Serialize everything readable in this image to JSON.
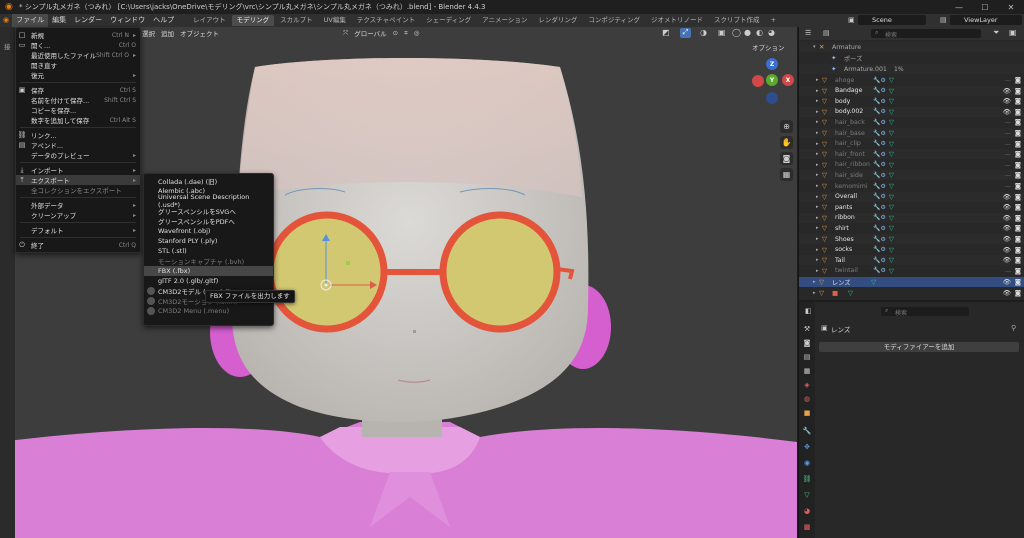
{
  "window": {
    "title": "* シンプル丸メガネ（つみれ） [C:\\Users\\jacks\\OneDrive\\モデリング\\vrc\\シンプル丸メガネ\\シンプル丸メガネ（つみれ）.blend] - Blender 4.4.3",
    "minimize": "—",
    "maximize": "☐",
    "close": "✕"
  },
  "topbar": {
    "menus": [
      "ファイル",
      "編集",
      "レンダー",
      "ウィンドウ",
      "ヘルプ"
    ],
    "workspaces": [
      "レイアウト",
      "モデリング",
      "スカルプト",
      "UV編集",
      "テクスチャペイント",
      "シェーディング",
      "アニメーション",
      "レンダリング",
      "コンポジティング",
      "ジオメトリノード",
      "スクリプト作成"
    ],
    "add_workspace": "+",
    "scene": "Scene",
    "view_layer": "ViewLayer"
  },
  "viewport": {
    "header_menus": [
      "選択",
      "追加",
      "オブジェクト"
    ],
    "transform_orientation": "グローバル",
    "options": "オプション",
    "left_label": "接",
    "gizmo": {
      "z": "Z",
      "y": "Y",
      "x": "X"
    }
  },
  "file_menu": {
    "items": [
      {
        "icon": "□",
        "label": "新規",
        "shortcut": "Ctrl N",
        "arrow": "▸"
      },
      {
        "icon": "▭",
        "label": "開く...",
        "shortcut": "Ctrl O",
        "arrow": ""
      },
      {
        "icon": "",
        "label": "最近使用したファイル",
        "shortcut": "Shift Ctrl O",
        "arrow": "▸"
      },
      {
        "icon": "",
        "label": "開き直す",
        "shortcut": "",
        "arrow": ""
      },
      {
        "icon": "",
        "label": "復元",
        "shortcut": "",
        "arrow": "▸"
      },
      {
        "icon": "▣",
        "label": "保存",
        "shortcut": "Ctrl S",
        "arrow": ""
      },
      {
        "icon": "",
        "label": "名前を付けて保存...",
        "shortcut": "Shift Ctrl S",
        "arrow": ""
      },
      {
        "icon": "",
        "label": "コピーを保存...",
        "shortcut": "",
        "arrow": ""
      },
      {
        "icon": "",
        "label": "数字を追加して保存",
        "shortcut": "Ctrl Alt S",
        "arrow": ""
      },
      {
        "icon": "⛓",
        "label": "リンク...",
        "shortcut": "",
        "arrow": ""
      },
      {
        "icon": "▤",
        "label": "アペンド...",
        "shortcut": "",
        "arrow": ""
      },
      {
        "icon": "",
        "label": "データのプレビュー",
        "shortcut": "",
        "arrow": "▸"
      },
      {
        "icon": "⤓",
        "label": "インポート",
        "shortcut": "",
        "arrow": "▸"
      },
      {
        "icon": "⤒",
        "label": "エクスポート",
        "shortcut": "",
        "arrow": "▸"
      },
      {
        "icon": "",
        "label": "全コレクションをエクスポート",
        "shortcut": "",
        "arrow": ""
      },
      {
        "icon": "",
        "label": "外部データ",
        "shortcut": "",
        "arrow": "▸"
      },
      {
        "icon": "",
        "label": "クリーンアップ",
        "shortcut": "",
        "arrow": "▸"
      },
      {
        "icon": "",
        "label": "デフォルト",
        "shortcut": "",
        "arrow": "▸"
      },
      {
        "icon": "⏻",
        "label": "終了",
        "shortcut": "Ctrl Q",
        "arrow": ""
      }
    ]
  },
  "export_menu": {
    "items": [
      {
        "label": "Collada (.dae) (旧)"
      },
      {
        "label": "Alembic (.abc)"
      },
      {
        "label": "Universal Scene Description (.usd*)"
      },
      {
        "label": "グリースペンシルをSVGへ"
      },
      {
        "label": "グリースペンシルをPDFへ"
      },
      {
        "label": "Wavefront (.obj)"
      },
      {
        "label": "Stanford PLY (.ply)"
      },
      {
        "label": "STL (.stl)"
      },
      {
        "label": "モーションキャプチャ (.bvh)"
      },
      {
        "label": "FBX (.fbx)"
      },
      {
        "label": "glTF 2.0 (.glb/.gltf)"
      },
      {
        "label": "CM3D2モデル (.model)"
      },
      {
        "label": "CM3D2モーション (.anm)"
      },
      {
        "label": "CM3D2 Menu (.menu)"
      }
    ]
  },
  "tooltip": "FBX ファイルを出力します",
  "outliner": {
    "search_placeholder": "検索",
    "armature": "Armature",
    "pose": "ポーズ",
    "armature_child": "Armature.001",
    "armature_child_count": "1%",
    "rows": [
      {
        "name": "ahoge",
        "dim": true
      },
      {
        "name": "Bandage",
        "dim": false
      },
      {
        "name": "body",
        "dim": false
      },
      {
        "name": "body.002",
        "dim": false
      },
      {
        "name": "hair_back",
        "dim": true
      },
      {
        "name": "hair_base",
        "dim": true
      },
      {
        "name": "hair_clip",
        "dim": true
      },
      {
        "name": "hair_front",
        "dim": true
      },
      {
        "name": "hair_ribbon",
        "dim": true
      },
      {
        "name": "hair_side",
        "dim": true
      },
      {
        "name": "kemomimi",
        "dim": true
      },
      {
        "name": "Overall",
        "dim": false
      },
      {
        "name": "pants",
        "dim": false
      },
      {
        "name": "ribbon",
        "dim": false
      },
      {
        "name": "shirt",
        "dim": false
      },
      {
        "name": "Shoes",
        "dim": false
      },
      {
        "name": "socks",
        "dim": false
      },
      {
        "name": "Tail",
        "dim": false
      },
      {
        "name": "twintail",
        "dim": true
      }
    ],
    "selected": "レンズ",
    "last_row_icon": "■"
  },
  "properties": {
    "search_placeholder": "検索",
    "object_name": "レンズ",
    "add_modifier": "モディファイアーを追加"
  },
  "colors": {
    "accent_orange": "#e87d0d",
    "selection_blue": "#334d80",
    "mesh_teal": "#22cc99"
  }
}
